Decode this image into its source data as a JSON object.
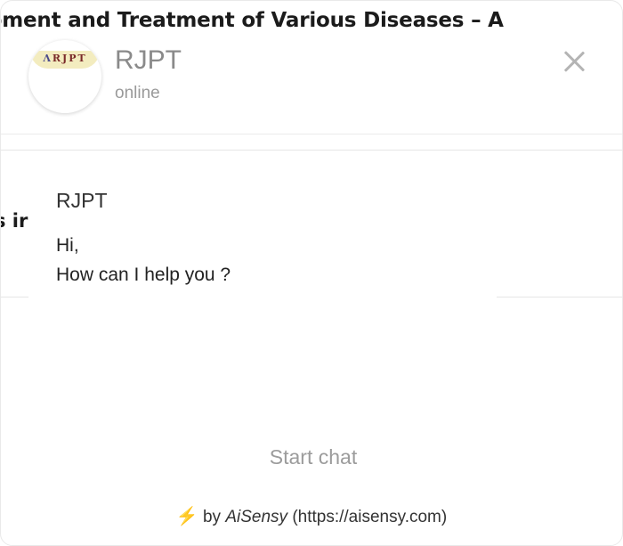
{
  "background_page": {
    "title_fragment": "pment and Treatment of Various Diseases – A",
    "text_fragment": "s ir"
  },
  "header": {
    "logo_text": "RJPT",
    "name": "RJPT",
    "status": "online"
  },
  "message": {
    "sender": "RJPT",
    "lines": [
      "Hi,",
      "How can I help you ?"
    ]
  },
  "actions": {
    "start_chat": "Start chat"
  },
  "footer": {
    "icon": "lightning-bolt-icon",
    "prefix": "by",
    "brand": "AiSensy",
    "url_text": "(https://aisensy.com)"
  },
  "colors": {
    "accent_bolt": "#f5a623",
    "muted_text": "#9c9c9c",
    "logo_background": "#f3ecbf"
  }
}
